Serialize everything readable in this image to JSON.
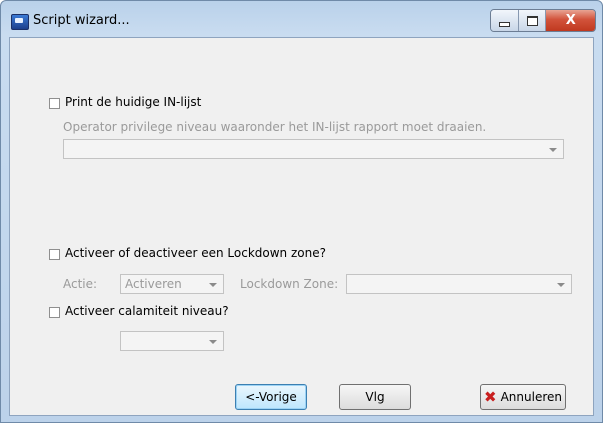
{
  "window": {
    "title": "Script wizard..."
  },
  "titlebar_buttons": {
    "minimize": "minimize-icon",
    "maximize": "maximize-icon",
    "close_glyph": "X"
  },
  "print_section": {
    "checkbox_label": "Print de huidige IN-lijst",
    "checked": false,
    "description": "Operator privilege niveau waaronder het IN-lijst rapport moet draaien.",
    "privilege_value": ""
  },
  "lockdown_section": {
    "checkbox_label": "Activeer of deactiveer een Lockdown zone?",
    "checked": false,
    "action_label": "Actie:",
    "action_value": "Activeren",
    "zone_label": "Lockdown Zone:",
    "zone_value": ""
  },
  "calamity_section": {
    "checkbox_label": "Activeer calamiteit niveau?",
    "checked": false,
    "level_value": ""
  },
  "buttons": {
    "previous": "<-Vorige",
    "next": "Vlg",
    "cancel": "Annuleren",
    "cancel_icon": "cancel-x-icon"
  },
  "colors": {
    "disabled_text": "#9a9a9a",
    "cancel_icon": "#c81e1e",
    "focus_border": "#3c7fb1"
  }
}
